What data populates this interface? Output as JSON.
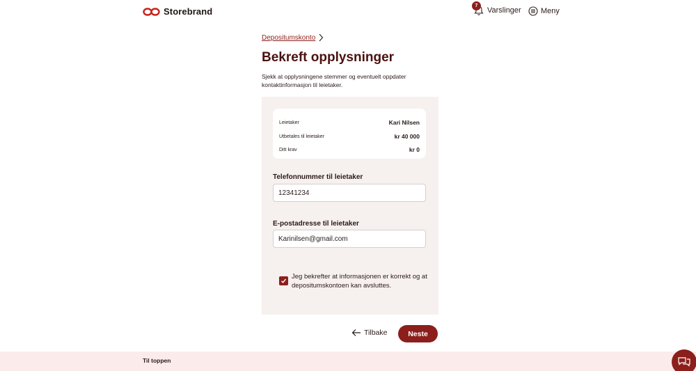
{
  "header": {
    "brand": "Storebrand",
    "notifications_label": "Varslinger",
    "notifications_count": "7",
    "menu_label": "Meny"
  },
  "breadcrumb": {
    "label": "Depositumskonto"
  },
  "page": {
    "title": "Bekreft opplysninger",
    "intro": "Sjekk at opplysningene stemmer og eventuelt oppdater kontaktinformasjon til leietaker."
  },
  "summary": {
    "rows": [
      {
        "label": "Leietaker",
        "value": "Kari Nilsen"
      },
      {
        "label": "Utbetales til leietaker",
        "value": "kr 40 000"
      },
      {
        "label": "Ditt krav",
        "value": "kr 0"
      }
    ]
  },
  "form": {
    "phone_label": "Telefonnummer til leietaker",
    "phone_value": "12341234",
    "email_label": "E-postadresse til leietaker",
    "email_value": "Karinilsen@gmail.com",
    "confirm_text": "Jeg bekrefter at informasjonen er korrekt og at depositumskontoen kan avsluttes.",
    "confirm_checked": true
  },
  "actions": {
    "back_label": "Tilbake",
    "next_label": "Neste"
  },
  "footer": {
    "to_top_label": "Til toppen"
  },
  "colors": {
    "brand": "#8c1f1b",
    "title": "#4a1210",
    "panel_bg": "#f6f0ee",
    "footer_bg": "#fbeceb"
  },
  "icons": [
    "storebrand-logo",
    "bell-icon",
    "menu-icon",
    "chevron-right-icon",
    "checkmark-icon",
    "arrow-left-icon",
    "chat-icon"
  ]
}
